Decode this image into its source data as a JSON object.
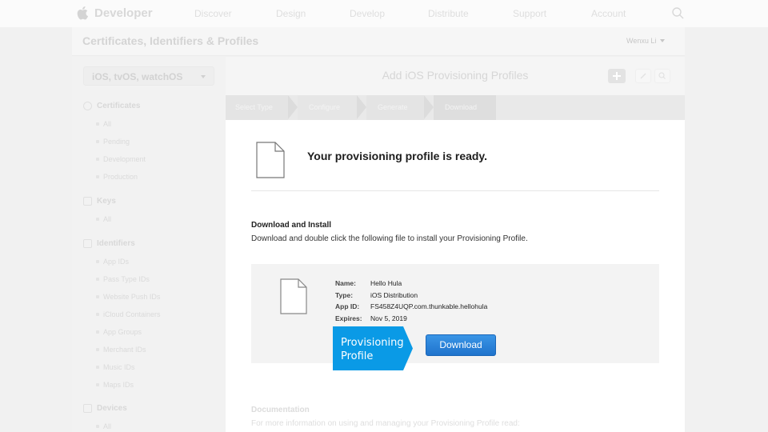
{
  "nav": {
    "brand": "Developer",
    "items": [
      "Discover",
      "Design",
      "Develop",
      "Distribute",
      "Support",
      "Account"
    ]
  },
  "subheader": {
    "title": "Certificates, Identifiers & Profiles",
    "user": "Wenxu Li"
  },
  "sidebar": {
    "platform": "iOS, tvOS, watchOS",
    "sections": [
      {
        "label": "Certificates",
        "items": [
          "All",
          "Pending",
          "Development",
          "Production"
        ]
      },
      {
        "label": "Keys",
        "items": [
          "All"
        ]
      },
      {
        "label": "Identifiers",
        "items": [
          "App IDs",
          "Pass Type IDs",
          "Website Push IDs",
          "iCloud Containers",
          "App Groups",
          "Merchant IDs",
          "Music IDs",
          "Maps IDs"
        ]
      },
      {
        "label": "Devices",
        "items": [
          "All"
        ]
      }
    ]
  },
  "main": {
    "title": "Add iOS Provisioning Profiles",
    "steps": [
      "Select Type",
      "Configure",
      "Generate",
      "Download"
    ],
    "ready_message": "Your provisioning profile is ready.",
    "download_title": "Download and Install",
    "download_desc": "Download and double click the following file to install your Provisioning Profile.",
    "profile": {
      "name_key": "Name:",
      "name": "Hello Hula",
      "type_key": "Type:",
      "type": "iOS Distribution",
      "appid_key": "App ID:",
      "app_id": "FS458Z4UQP.com.thunkable.hellohula",
      "expires_key": "Expires:",
      "expires": "Nov 5, 2019"
    },
    "download_button": "Download",
    "documentation_title": "Documentation",
    "documentation_desc": "For more information on using and managing your Provisioning Profile read:"
  },
  "callout": {
    "line1": "Provisioning",
    "line2": "Profile",
    "color": "#0a9ae6"
  }
}
